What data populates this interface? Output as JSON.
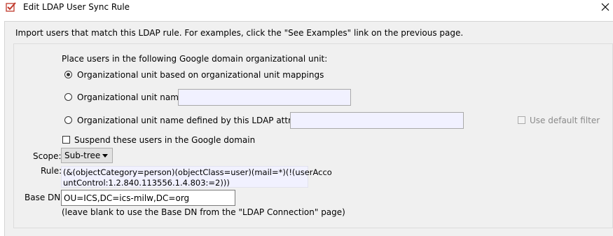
{
  "window": {
    "title": "Edit LDAP User Sync Rule",
    "icon": "checkmark-pencil-icon",
    "close_icon": "close-icon"
  },
  "intro": "Import users that match this LDAP rule.  For examples, click the \"See Examples\" link on the previous page.",
  "placement": {
    "heading": "Place users in the following Google domain organizational unit:",
    "option_mappings": "Organizational unit based on organizational unit mappings",
    "option_name": "Organizational unit name:",
    "option_name_value": "",
    "option_attribute": "Organizational unit name defined by this LDAP attribute:",
    "option_attribute_value": "",
    "selected": "mappings"
  },
  "use_default_filter": "Use default filter",
  "suspend_users": "Suspend these users in the Google domain",
  "scope": {
    "label": "Scope:",
    "value": "Sub-tree"
  },
  "rule": {
    "label": "Rule:",
    "line1": "(&(objectCategory=person)(objectClass=user)(mail=*)(!(userAcco",
    "line2": "untControl:1.2.840.113556.1.4.803:=2)))"
  },
  "base_dn": {
    "label": "Base DN:",
    "value": "OU=ICS,DC=ics-milw,DC=org",
    "hint": "(leave blank to use the Base DN from the \"LDAP Connection\" page)"
  },
  "colors": {
    "field_bg": "#f1f1ff",
    "panel_bg": "#f0f0f0"
  }
}
